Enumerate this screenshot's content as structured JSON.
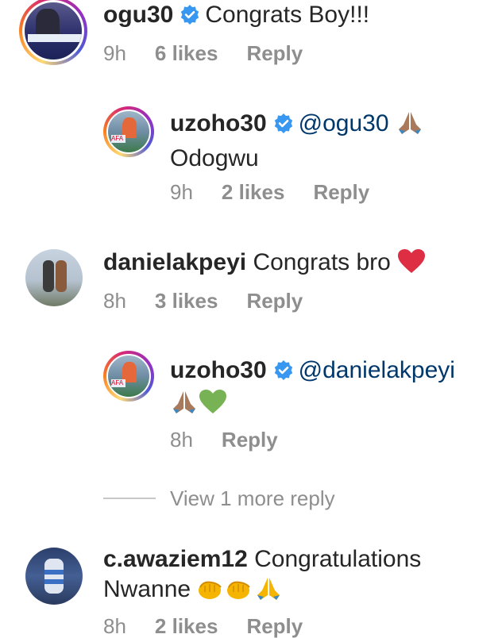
{
  "comments": [
    {
      "username": "ogu30",
      "verified": true,
      "text": "Congrats Boy!!!",
      "time": "9h",
      "likes": "6 likes",
      "reply": "Reply"
    },
    {
      "username": "uzoho30",
      "verified": true,
      "mention": "@ogu30",
      "text": "Odogwu",
      "time": "9h",
      "likes": "2 likes",
      "reply": "Reply"
    },
    {
      "username": "danielakpeyi",
      "verified": false,
      "text": "Congrats bro",
      "time": "8h",
      "likes": "3 likes",
      "reply": "Reply"
    },
    {
      "username": "uzoho30",
      "verified": true,
      "mention": "@danielakpeyi",
      "text": "",
      "time": "8h",
      "reply": "Reply"
    },
    {
      "username": "c.awaziem12",
      "verified": false,
      "text": "Congratulations",
      "text2": "Nwanne",
      "time": "8h",
      "likes": "2 likes",
      "reply": "Reply"
    }
  ],
  "view_more": "View 1 more reply",
  "colors": {
    "text": "#262626",
    "meta": "#8e8e8e",
    "mention": "#00376b",
    "verified": "#3897f0",
    "heart_red": "#e0245e",
    "heart_green": "#77b255"
  },
  "icons": [
    "verified-badge-icon",
    "folded-hands-icon",
    "red-heart-icon",
    "green-heart-icon",
    "clapping-hands-icon"
  ]
}
